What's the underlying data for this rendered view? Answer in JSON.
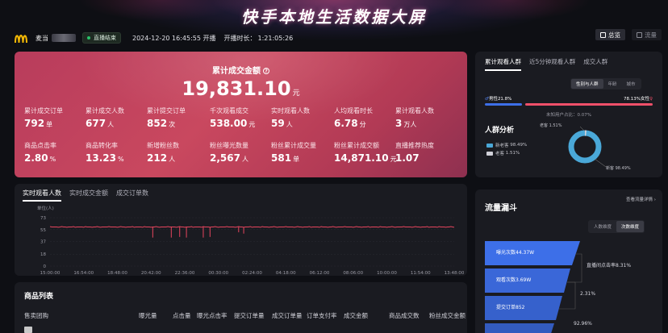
{
  "page_title": "快手本地生活数据大屏",
  "header": {
    "shop_name": "麦当",
    "live_status": "直播结束",
    "start_time": "2024-12-20 16:45:55 开播",
    "duration_label": "开播时长：",
    "duration_value": "1:21:05:26",
    "buttons": [
      "总览",
      "流量"
    ]
  },
  "summary": {
    "hero_label": "累计成交金额",
    "hero_value": "19,831.10",
    "hero_unit": "元",
    "metrics": [
      {
        "label": "累计成交订单",
        "value": "792",
        "unit": "单"
      },
      {
        "label": "累计成交人数",
        "value": "677",
        "unit": "人"
      },
      {
        "label": "累计提交订单",
        "value": "852",
        "unit": "次"
      },
      {
        "label": "千次观看成交",
        "value": "538.00",
        "unit": "元"
      },
      {
        "label": "实时观看人数",
        "value": "59",
        "unit": "人"
      },
      {
        "label": "人均观看时长",
        "value": "6.78",
        "unit": "分"
      },
      {
        "label": "累计观看人数",
        "value": "3",
        "unit": "万人"
      },
      {
        "label": "商品点击率",
        "value": "2.80",
        "unit": "%"
      },
      {
        "label": "商品转化率",
        "value": "13.23",
        "unit": "%"
      },
      {
        "label": "新增粉丝数",
        "value": "212",
        "unit": "人"
      },
      {
        "label": "粉丝曝光数量",
        "value": "2,567",
        "unit": "人"
      },
      {
        "label": "粉丝累计成交量",
        "value": "581",
        "unit": "单"
      },
      {
        "label": "粉丝累计成交额",
        "value": "14,871.10",
        "unit": "元"
      },
      {
        "label": "直播推荐热度",
        "value": "1.07",
        "unit": ""
      }
    ]
  },
  "realtime": {
    "tabs": [
      "实时观看人数",
      "实时成交金额",
      "成交订单数"
    ],
    "active_tab": 0
  },
  "chart_data": {
    "type": "line",
    "ylabel": "单位(人)",
    "y_ticks": [
      0,
      18,
      37,
      55,
      73
    ],
    "ylim": [
      0,
      73
    ],
    "x_ticks": [
      "15:00:00",
      "16:54:00",
      "18:48:00",
      "20:42:00",
      "22:36:00",
      "00:30:00",
      "02:24:00",
      "04:18:00",
      "06:12:00",
      "08:06:00",
      "10:00:00",
      "11:54:00",
      "13:48:00"
    ],
    "series_color": "#e8455e",
    "baseline": 59,
    "dips": [
      {
        "x": 3.05,
        "y": 43
      },
      {
        "x": 3.6,
        "y": 43
      },
      {
        "x": 3.85,
        "y": 44
      },
      {
        "x": 4.05,
        "y": 43
      },
      {
        "x": 4.55,
        "y": 43
      },
      {
        "x": 4.75,
        "y": 44
      },
      {
        "x": 5.6,
        "y": 51
      },
      {
        "x": 5.75,
        "y": 49
      }
    ],
    "x_range": [
      0,
      12
    ]
  },
  "goods": {
    "title": "商品列表",
    "columns": [
      "售卖团购",
      "曝光量",
      "点击量",
      "曝光点击率",
      "提交订单量",
      "成交订单量",
      "订单支付率",
      "成交金额",
      "商品成交数",
      "粉丝成交金额"
    ]
  },
  "audience": {
    "tabs": [
      "累计观看人群",
      "近5分钟观看人群",
      "成交人群"
    ],
    "segments": [
      "性别与人群",
      "年龄",
      "城市"
    ],
    "male_label": "男性21.8%",
    "female_label": "78.13%女性",
    "unknown_label": "未知用户占比：0.07%",
    "crowd_title": "人群分析",
    "legend": [
      {
        "name": "新老客",
        "value": "98.49%",
        "color": "#4aa8d8"
      },
      {
        "name": "老客",
        "value": "1.51%",
        "color": "#d0d0d8"
      }
    ],
    "donut_old_label": "老客 1.51%",
    "donut_new_label": "新客 98.49%",
    "new_share": 98.49,
    "old_share": 1.51
  },
  "funnel": {
    "title": "流量漏斗",
    "link": "查看流量详情",
    "segments": [
      "人数维度",
      "次数维度"
    ],
    "steps": [
      {
        "label": "曝光次数44.37W",
        "color": "#3d6fe8"
      },
      {
        "label": "观看次数3.69W",
        "color": "#3a67d8"
      },
      {
        "label": "提交订单852",
        "color": "#3661cc"
      },
      {
        "label": "",
        "color": "#335bbf"
      }
    ],
    "rates": [
      "直播间点击率8.31%",
      "2.31%",
      "92.96%"
    ]
  }
}
